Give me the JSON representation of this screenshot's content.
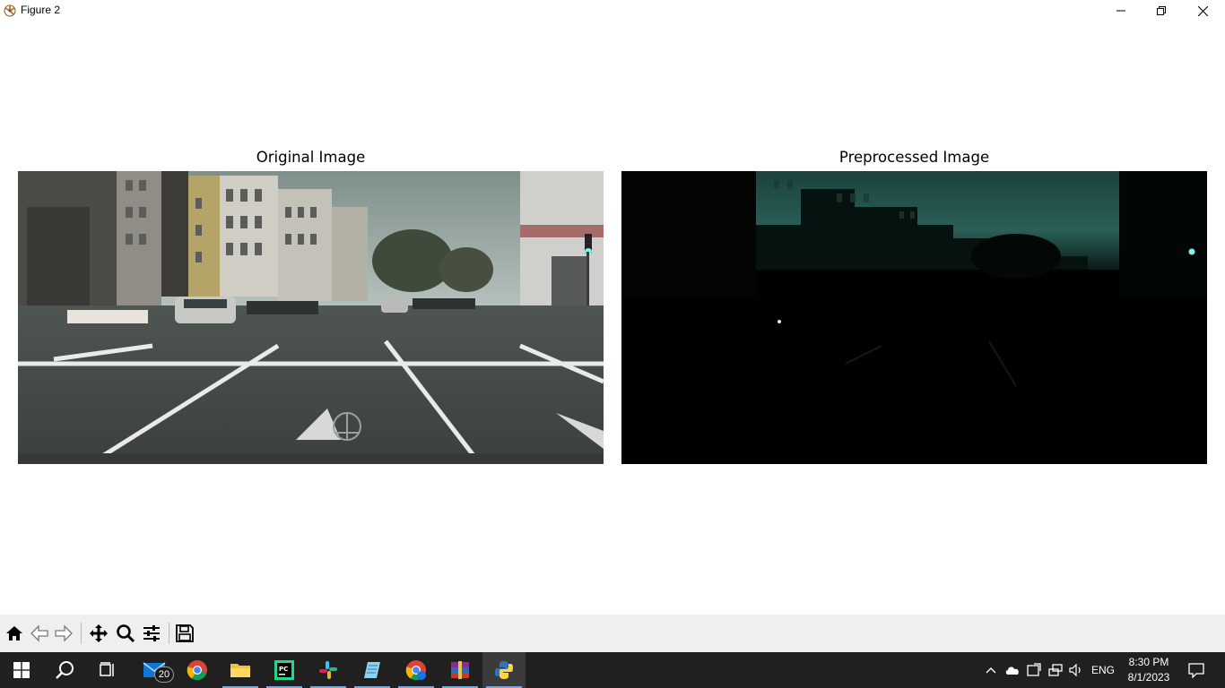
{
  "window": {
    "title": "Figure 2"
  },
  "figure": {
    "axes": [
      {
        "title": "Original Image",
        "image": "city-street-photo"
      },
      {
        "title": "Preprocessed Image",
        "image": "dark-teal-preprocessed-street"
      }
    ]
  },
  "toolbar": {
    "buttons": [
      "home-icon",
      "back-arrow-icon",
      "forward-arrow-icon",
      "pan-icon",
      "zoom-icon",
      "configure-subplots-icon",
      "save-icon"
    ]
  },
  "taskbar": {
    "apps": [
      "windows-start-icon",
      "search-icon",
      "task-view-icon",
      "mail-icon",
      "chrome-icon",
      "file-explorer-icon",
      "pycharm-icon",
      "slack-icon",
      "notepad-icon",
      "chrome-profile-icon",
      "winrar-icon",
      "python-icon"
    ],
    "mail_badge": "20",
    "language": "ENG",
    "time": "8:30 PM",
    "date": "8/1/2023"
  }
}
